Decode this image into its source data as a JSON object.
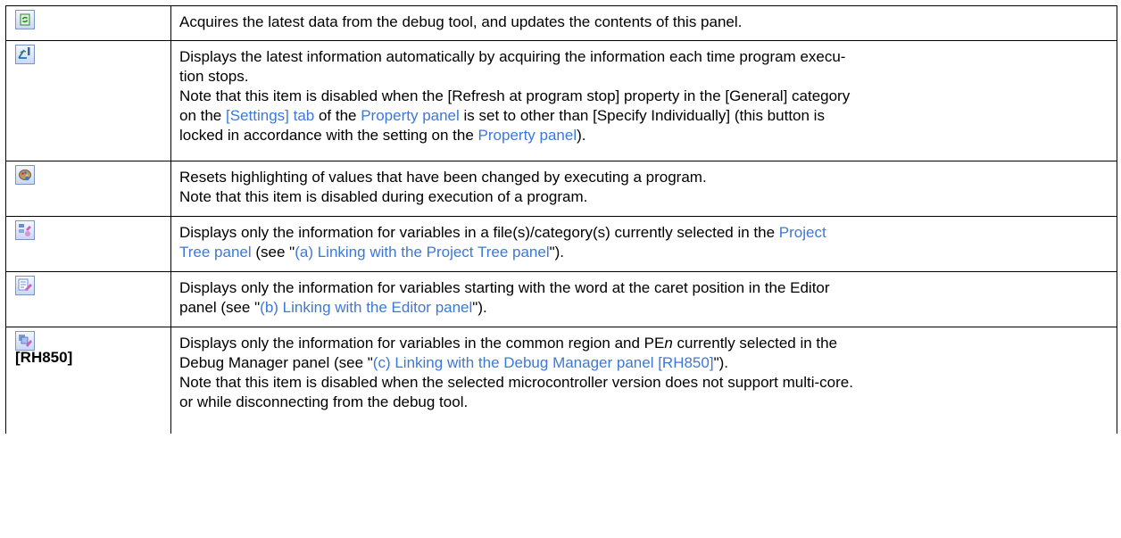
{
  "rows": [
    {
      "icon": "refresh-icon",
      "lines": [
        {
          "t": "Acquires the latest data from the debug tool, and updates the contents of this panel."
        }
      ]
    },
    {
      "icon": "auto-refresh-icon",
      "lines": [
        {
          "t": "Displays the latest information automatically by acquiring the information each time program execu-"
        },
        {
          "t": "tion stops."
        },
        {
          "t": "Note that this item is disabled when the [Refresh at program stop] property in the [General] category"
        },
        {
          "a": "on the ",
          "l1": "[Settings] tab",
          "b": " of the ",
          "l2": "Property panel",
          "c": " is set to other than [Specify Individually] (this button is"
        },
        {
          "a": "locked in accordance with the setting on the ",
          "l1": "Property panel",
          "b": ")."
        }
      ]
    },
    {
      "icon": "reset-highlight-icon",
      "lines": [
        {
          "t": "Resets highlighting of values that have been changed by executing a program."
        },
        {
          "t": "Note that this item is disabled during execution of a program."
        }
      ]
    },
    {
      "icon": "link-project-tree-icon",
      "lines": [
        {
          "a": "Displays only the information for variables in a file(s)/category(s) currently selected in the ",
          "l1": "Project"
        },
        {
          "l1": "Tree panel",
          "a": " (see \"",
          "l2": "(a)  Linking with the Project Tree panel",
          "b": "\")."
        }
      ]
    },
    {
      "icon": "link-editor-icon",
      "lines": [
        {
          "t": "Displays only the information for variables starting with the word at the caret position in the Editor"
        },
        {
          "a": "panel (see \"",
          "l1": "(b)  Linking with the Editor panel",
          "b": "\")."
        }
      ]
    },
    {
      "icon": "link-debug-manager-icon",
      "tag": "[RH850]",
      "lines": [
        {
          "a": "Displays only the information for variables in the common region and PE",
          "em": "n",
          "b": " currently selected in the"
        },
        {
          "a": "Debug Manager panel (see \"",
          "l1": "(c)  Linking with the Debug Manager panel [RH850]",
          "b": "\")."
        },
        {
          "t": "Note that this item is disabled when the selected microcontroller version does not support multi-core."
        },
        {
          "t": "or while disconnecting from the debug tool."
        }
      ]
    }
  ]
}
